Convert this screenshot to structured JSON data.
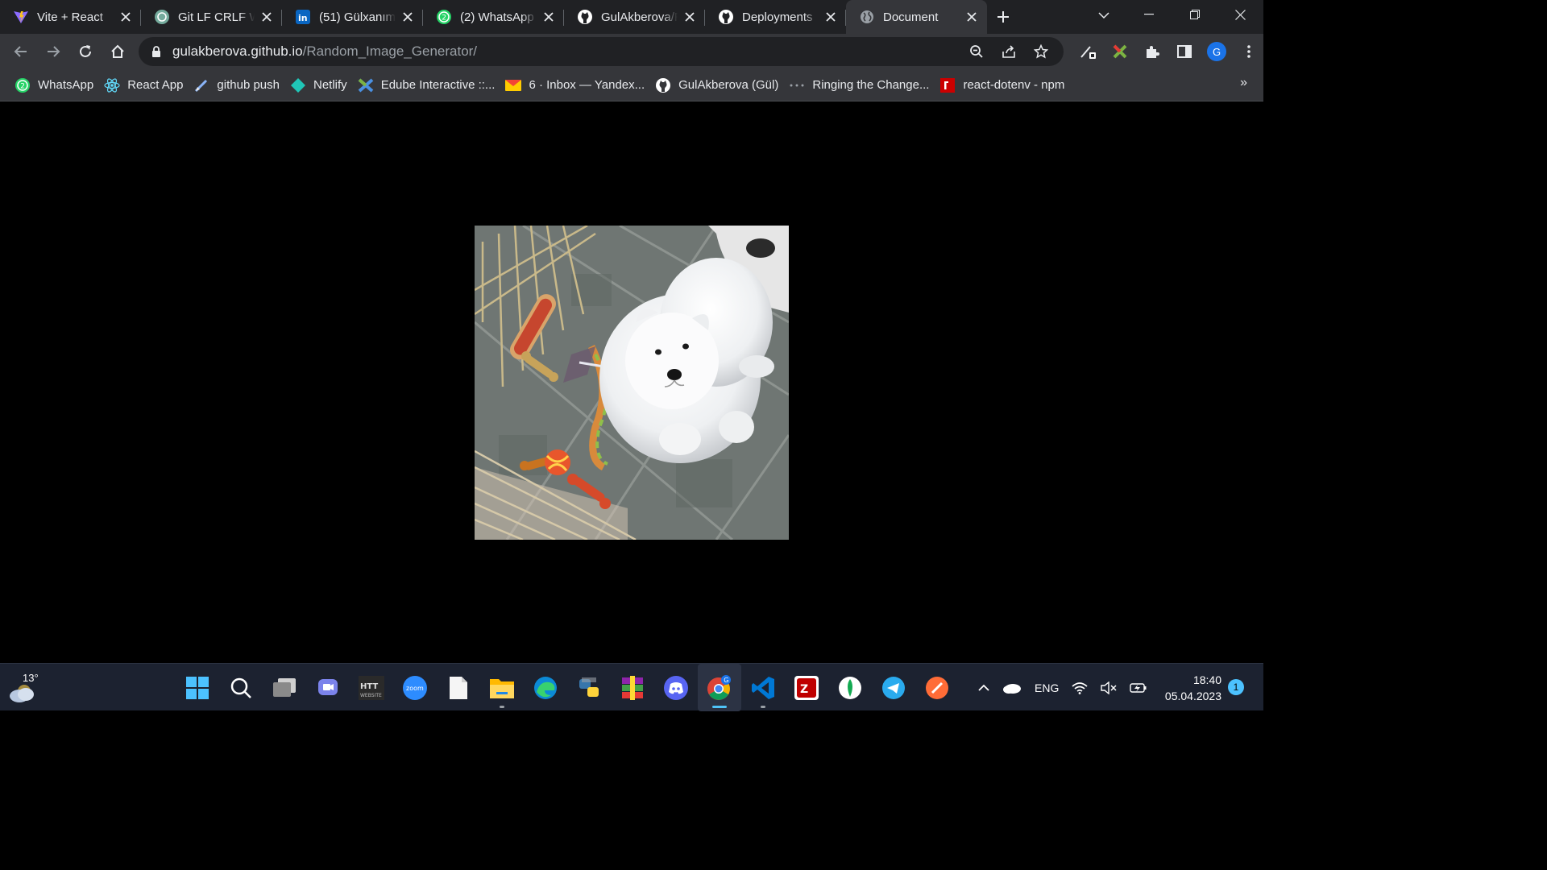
{
  "browser": {
    "tabs": [
      {
        "title": "Vite + React",
        "icon": "vite-icon"
      },
      {
        "title": "Git LF CRLF Wa",
        "icon": "chatgpt-icon"
      },
      {
        "title": "(51) Gülxanım",
        "icon": "linkedin-icon"
      },
      {
        "title": "(2) WhatsApp",
        "icon": "whatsapp-icon"
      },
      {
        "title": "GulAkberova/R",
        "icon": "github-icon"
      },
      {
        "title": "Deployments",
        "icon": "github-icon"
      },
      {
        "title": "Document",
        "icon": "globe-icon",
        "active": true
      }
    ],
    "address": {
      "host": "gulakberova.github.io",
      "path": "/Random_Image_Generator/"
    },
    "profile_initial": "G",
    "bookmarks": [
      {
        "label": "WhatsApp",
        "icon": "whatsapp-icon"
      },
      {
        "label": "React App",
        "icon": "react-icon"
      },
      {
        "label": "github push",
        "icon": "pen-icon"
      },
      {
        "label": "Netlify",
        "icon": "netlify-icon"
      },
      {
        "label": "Edube Interactive ::...",
        "icon": "edube-icon"
      },
      {
        "label": "6 · Inbox — Yandex...",
        "icon": "mail-icon"
      },
      {
        "label": "GulAkberova (Gül)",
        "icon": "github-icon"
      },
      {
        "label": "Ringing the Change...",
        "icon": "dots-icon"
      },
      {
        "label": "react-dotenv - npm",
        "icon": "npm-icon"
      }
    ],
    "bookmarks_more": "»"
  },
  "page": {
    "image_alt": "Random image: fluffy white puppy lying on a tiled floor in a pen with toys"
  },
  "taskbar": {
    "weather_temp": "13°",
    "language": "ENG",
    "time": "18:40",
    "date": "05.04.2023",
    "notification_count": "1",
    "colors": {
      "accent": "#4fc3f7",
      "taskbar_bg": "#1c2230"
    }
  }
}
